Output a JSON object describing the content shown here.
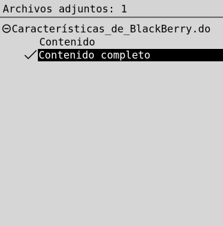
{
  "header": {
    "title": "Archivos adjuntos: 1"
  },
  "attachments": [
    {
      "filename": "Características_de_BlackBerry.do",
      "expanded_icon": "collapse-minus-icon",
      "options": [
        {
          "label": "Contenido",
          "checked": false,
          "selected": false
        },
        {
          "label": "Contenido completo",
          "checked": true,
          "selected": true
        }
      ]
    }
  ],
  "colors": {
    "background": "#d6d6d6",
    "selection": "#000000",
    "selection_text": "#ffffff",
    "divider": "#6e6e6e"
  }
}
